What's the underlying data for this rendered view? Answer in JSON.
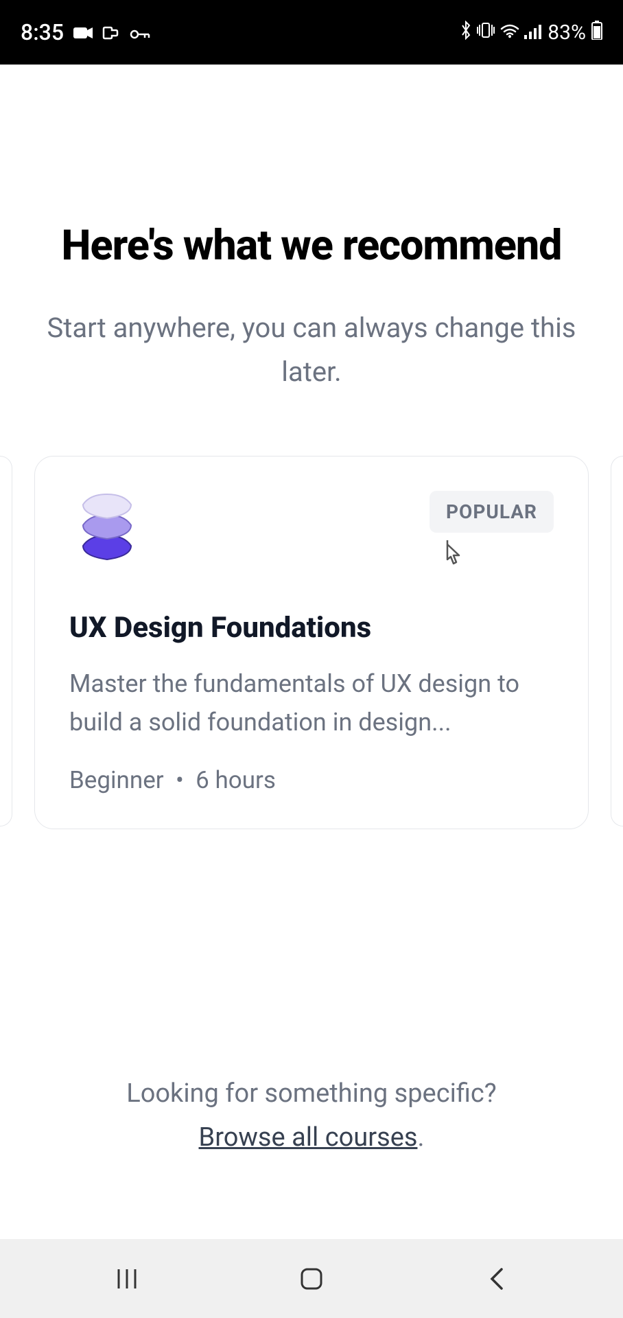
{
  "status_bar": {
    "time": "8:35",
    "battery": "83%"
  },
  "page": {
    "title": "Here's what we recommend",
    "subtitle": "Start anywhere, you can always change this later."
  },
  "course": {
    "badge": "POPULAR",
    "title": "UX Design Foundations",
    "description": "Master the fundamentals of UX design to build a solid foundation in design...",
    "level": "Beginner",
    "duration": "6 hours"
  },
  "bottom": {
    "prompt": "Looking for something specific?",
    "link_text": "Browse all courses",
    "period": "."
  }
}
